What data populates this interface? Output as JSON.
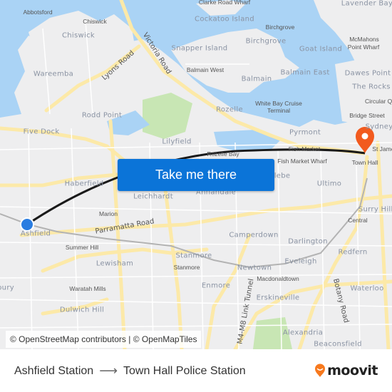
{
  "map": {
    "cta_label": "Take me there",
    "attribution": "© OpenStreetMap contributors | © OpenMapTiles",
    "origin_color": "#2a7de1",
    "destination_color": "#f25a1e",
    "route_color": "#1a1a1a",
    "labels": {
      "abbotsford": "Abbotsford",
      "chiswick_sm": "Chiswick",
      "chiswick": "Chiswick",
      "wareemba": "Wareemba",
      "lyons_road": "Lyons Road",
      "victoria_road": "Victoria Road",
      "rodd_point": "Rodd Point",
      "five_dock": "Five Dock",
      "cockatoo": "Cockatoo Island",
      "clarke": "Clarke Road Wharf",
      "birchgrove_sm": "Birchgrove",
      "birchgrove": "Birchgrove",
      "snapper": "Snapper Island",
      "goat": "Goat Island",
      "balmain_west": "Balmain West",
      "balmain": "Balmain",
      "balmain_east": "Balmain East",
      "lavender": "Lavender Bay",
      "mcmahons": "McMahons",
      "mcmahons2": "Point Wharf",
      "dawes": "Dawes Point",
      "rocks": "The Rocks",
      "circular": "Circular Quay",
      "bridge": "Bridge Street",
      "sydney": "Sydney",
      "white_bay": "White Bay Cruise",
      "white_bay2": "Terminal",
      "rozelle": "Rozelle",
      "lilyfield": "Lilyfield",
      "pyrmont": "Pyrmont",
      "rozelle_bay": "Rozelle Bay",
      "fish_market": "Fish Market",
      "fish_wharf": "Fish Market Wharf",
      "st_james": "St James",
      "town_hall": "Town Hall",
      "haberfield": "Haberfield",
      "leichhardt": "Leichhardt",
      "annandale": "Annandale",
      "glebe": "Glebe",
      "ultimo": "Ultimo",
      "surry_hills": "Surry Hills",
      "central": "Central",
      "marion": "Marion",
      "ashfield": "Ashfield",
      "parramatta": "Parramatta Road",
      "camperdown": "Camperdown",
      "darlington": "Darlington",
      "redfern": "Redfern",
      "summer_hill": "Summer Hill",
      "lewisham": "Lewisham",
      "stanmore": "Stanmore",
      "stanmore_sm": "Stanmore",
      "newtown": "Newtown",
      "eveleigh": "Eveleigh",
      "macdonaldtown": "Macdonaldtown",
      "enmore": "Enmore",
      "waratah": "Waratah Mills",
      "dulwich": "Dulwich Hill",
      "erskineville": "Erskineville",
      "m4m8": "M4-M8 Link Tunnel",
      "botany": "Botany Road",
      "waterloo": "Waterloo",
      "alexandria": "Alexandria",
      "beaconsfield": "Beaconsfield",
      "bury": "bury"
    }
  },
  "footer": {
    "origin": "Ashfield Station",
    "destination": "Town Hall Police Station",
    "brand": "moovit",
    "brand_color": "#f7791e"
  }
}
